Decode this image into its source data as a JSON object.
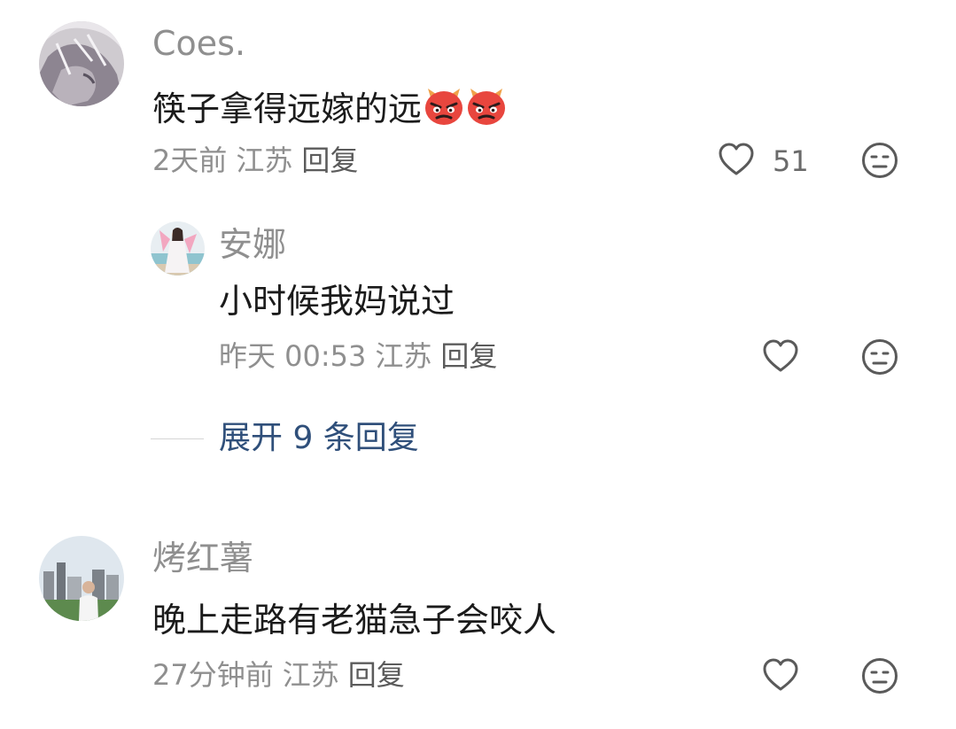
{
  "comments": [
    {
      "username": "Coes.",
      "content": "筷子拿得远嫁的远",
      "emojis": [
        "angry-devil-emoji",
        "angry-devil-emoji"
      ],
      "time": "2天前",
      "location": "江苏",
      "reply_label": "回复",
      "like_count": "51",
      "like_icon": "heart-outline-icon",
      "dislike_icon": "meh-face-icon",
      "replies": [
        {
          "username": "安娜",
          "content": "小时候我妈说过",
          "time": "昨天 00:53",
          "location": "江苏",
          "reply_label": "回复",
          "like_icon": "heart-outline-icon",
          "dislike_icon": "meh-face-icon"
        }
      ],
      "expand_label": "展开 9 条回复"
    },
    {
      "username": "烤红薯",
      "content": "晚上走路有老猫急子会咬人",
      "time": "27分钟前",
      "location": "江苏",
      "reply_label": "回复",
      "like_icon": "heart-outline-icon",
      "dislike_icon": "meh-face-icon"
    }
  ],
  "colors": {
    "username": "#8f8f8f",
    "content": "#1b1b1b",
    "meta": "#8f8f8f",
    "expand": "#2f4f7a",
    "icon": "#5a5a5a"
  }
}
